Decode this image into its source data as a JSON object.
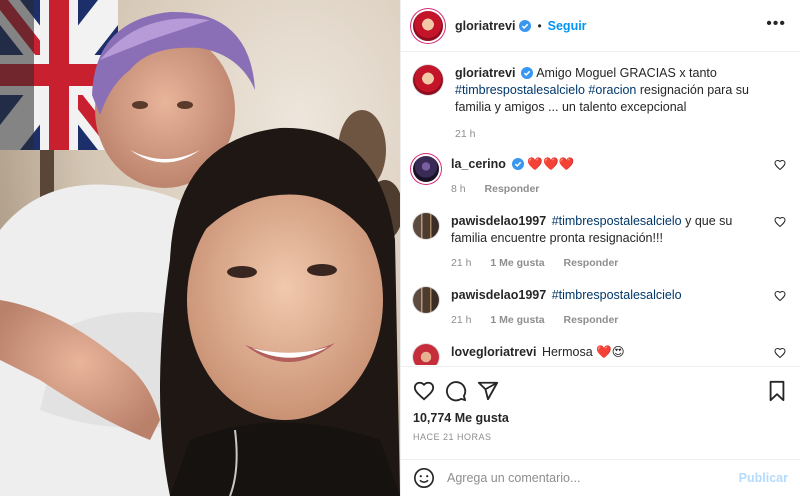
{
  "post": {
    "author": "gloriatrevi",
    "follow_label": "Seguir",
    "more_label": "•••",
    "dot": "•"
  },
  "caption": {
    "author": "gloriatrevi",
    "text_before": " Amigo Moguel GRACIAS x tanto",
    "hashtag_1": "#timbrespostalesalcielo",
    "hashtag_2": "#oracion",
    "text_after": " resignación para su familia y amigos ... un talento excepcional",
    "time": "21 h"
  },
  "comments": [
    {
      "user": "la_cerino",
      "text": "❤️❤️❤️",
      "time": "8 h",
      "likes": "",
      "reply": "Responder"
    },
    {
      "user": "pawisdelao1997",
      "hashtag": "#timbrespostalesalcielo",
      "text": " y que su familia encuentre pronta resignación!!!",
      "time": "21 h",
      "likes": "1 Me gusta",
      "reply": "Responder"
    },
    {
      "user": "pawisdelao1997",
      "hashtag": "#timbrespostalesalcielo",
      "text": "",
      "time": "21 h",
      "likes": "1 Me gusta",
      "reply": "Responder"
    },
    {
      "user": "lovegloriatrevi",
      "text": "Hermosa ❤️😍",
      "time": "",
      "likes": "",
      "reply": ""
    }
  ],
  "stats": {
    "likes": "10,774 Me gusta",
    "time_ago": "HACE 21 HORAS"
  },
  "add_comment": {
    "placeholder": "Agrega un comentario...",
    "publish_label": "Publicar"
  },
  "icons": [
    "verified-icon",
    "heart-icon",
    "comment-icon",
    "share-icon",
    "save-icon",
    "emoji-icon",
    "more-icon"
  ],
  "colors": {
    "link": "#0095f6",
    "hashtag": "#00376b",
    "muted": "#8e8e8e",
    "publish_disabled": "#b3dbff"
  }
}
